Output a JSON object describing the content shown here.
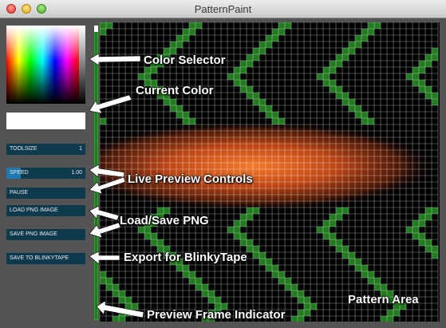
{
  "window": {
    "title": "PatternPaint"
  },
  "controls": {
    "toolsize": {
      "label": "TOOLSIZE",
      "value": "1"
    },
    "speed": {
      "label": "SPEED",
      "value": "1.00",
      "level": 0.18
    },
    "pause": {
      "label": "PAUSE"
    },
    "load": {
      "label": "LOAD PNG IMAGE"
    },
    "save": {
      "label": "SAVE PNG IMAGE"
    },
    "export": {
      "label": "SAVE TO BLINKYTAPE"
    }
  },
  "current_color": "#ffffff",
  "annotations": {
    "color_selector": "Color Selector",
    "current_color": "Current Color",
    "live_preview": "Live Preview Controls",
    "load_save": "Load/Save PNG",
    "export": "Export for BlinkyTape",
    "pattern_area": "Pattern Area",
    "preview_frame": "Preview Frame Indicator"
  },
  "colors": {
    "background": "#545454",
    "control_bg": "#0e3a4e",
    "control_fill": "#1c78ad",
    "pattern_green": "#1f7d1f",
    "pattern_orange": "#e25a1c"
  }
}
